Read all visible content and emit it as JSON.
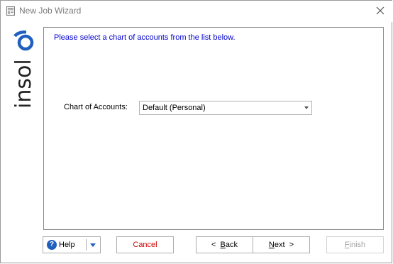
{
  "window": {
    "title": "New Job Wizard"
  },
  "brand": {
    "logo_text": "insol6"
  },
  "main": {
    "instruction": "Please select a chart of accounts from the list below.",
    "coa_label": "Chart of Accounts:",
    "coa_selected": "Default (Personal)"
  },
  "buttons": {
    "help": "Help",
    "cancel": "Cancel",
    "back_arrow": "<",
    "back_key": "B",
    "back_rest": "ack",
    "next_key": "N",
    "next_rest": "ext",
    "next_arrow": ">",
    "finish_key": "F",
    "finish_rest": "inish"
  },
  "colors": {
    "instruction_text": "#0000cc",
    "cancel_text": "#cc0000",
    "disabled_text": "#a0a0a0",
    "help_icon": "#1f5fbf"
  }
}
